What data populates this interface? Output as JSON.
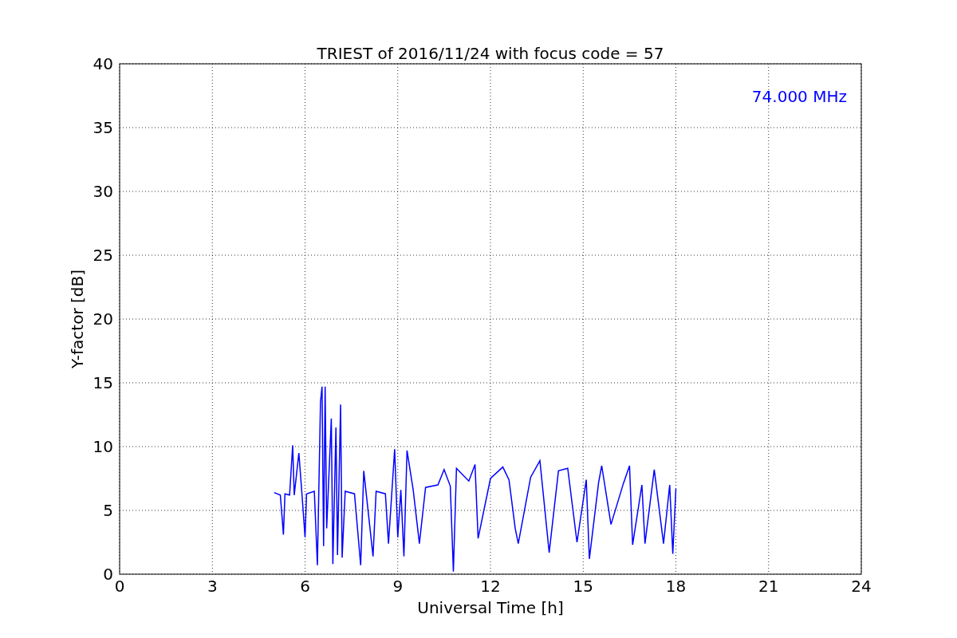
{
  "chart_data": {
    "type": "line",
    "title": "TRIEST of 2016/11/24 with focus code = 57",
    "xlabel": "Universal Time [h]",
    "ylabel": "Y-factor [dB]",
    "xlim": [
      0,
      24
    ],
    "ylim": [
      0,
      40
    ],
    "xticks": [
      0,
      3,
      6,
      9,
      12,
      15,
      18,
      21,
      24
    ],
    "yticks": [
      0,
      5,
      10,
      15,
      20,
      25,
      30,
      35,
      40
    ],
    "x": [
      5.0,
      5.2,
      5.3,
      5.35,
      5.5,
      5.6,
      5.65,
      5.8,
      5.9,
      6.0,
      6.05,
      6.3,
      6.4,
      6.5,
      6.55,
      6.6,
      6.65,
      6.7,
      6.85,
      6.9,
      7.0,
      7.05,
      7.15,
      7.2,
      7.3,
      7.6,
      7.8,
      7.9,
      8.2,
      8.3,
      8.6,
      8.7,
      8.9,
      9.0,
      9.1,
      9.2,
      9.3,
      9.5,
      9.7,
      9.9,
      10.3,
      10.5,
      10.7,
      10.8,
      10.9,
      11.3,
      11.5,
      11.6,
      12.0,
      12.4,
      12.6,
      12.8,
      12.9,
      13.3,
      13.6,
      13.9,
      14.2,
      14.5,
      14.8,
      15.1,
      15.2,
      15.5,
      15.6,
      15.9,
      16.3,
      16.5,
      16.6,
      16.9,
      17.0,
      17.3,
      17.6,
      17.8,
      17.9,
      18.0
    ],
    "series": [
      {
        "name": "74.000 MHz",
        "color": "#0000ff",
        "values": [
          6.4,
          6.2,
          3.1,
          6.3,
          6.2,
          10.1,
          6.2,
          9.5,
          6.3,
          2.9,
          6.3,
          6.5,
          0.7,
          13.5,
          14.7,
          2.2,
          14.7,
          3.6,
          12.2,
          0.8,
          11.5,
          1.5,
          13.3,
          1.3,
          6.5,
          6.3,
          0.7,
          8.1,
          1.4,
          6.5,
          6.3,
          2.4,
          9.8,
          2.9,
          6.6,
          1.4,
          9.7,
          6.6,
          2.4,
          6.8,
          7.0,
          8.2,
          6.9,
          0.2,
          8.3,
          7.3,
          8.6,
          2.8,
          7.5,
          8.4,
          7.4,
          3.6,
          2.4,
          7.6,
          8.9,
          1.7,
          8.1,
          8.3,
          2.5,
          7.4,
          1.2,
          7.2,
          8.5,
          3.9,
          7.1,
          8.5,
          2.3,
          7.0,
          2.4,
          8.2,
          2.4,
          7.0,
          1.6,
          6.7
        ]
      }
    ],
    "grid": true
  }
}
